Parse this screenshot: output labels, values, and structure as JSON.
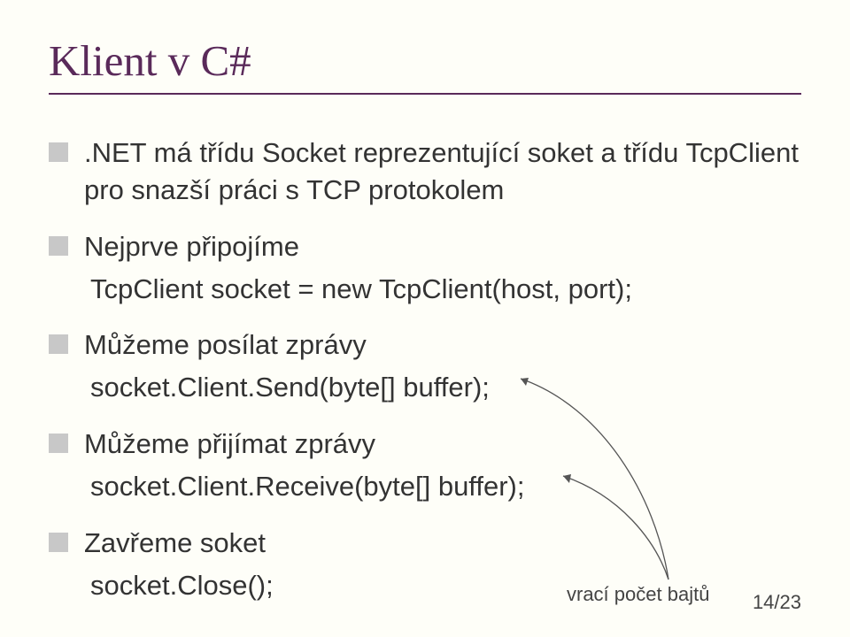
{
  "title": "Klient v C#",
  "bullets": [
    ".NET má třídu Socket reprezentující soket a třídu TcpClient pro snazší práci s TCP protokolem",
    "Nejprve připojíme",
    "Můžeme posílat zprávy",
    "Můžeme přijímat zprávy",
    "Zavřeme soket"
  ],
  "code": [
    "TcpClient socket = new TcpClient(host, port);",
    "socket.Client.Send(byte[] buffer);",
    "socket.Client.Receive(byte[] buffer);",
    "socket.Close();"
  ],
  "caption": "vrací počet bajtů",
  "page": "14/23"
}
